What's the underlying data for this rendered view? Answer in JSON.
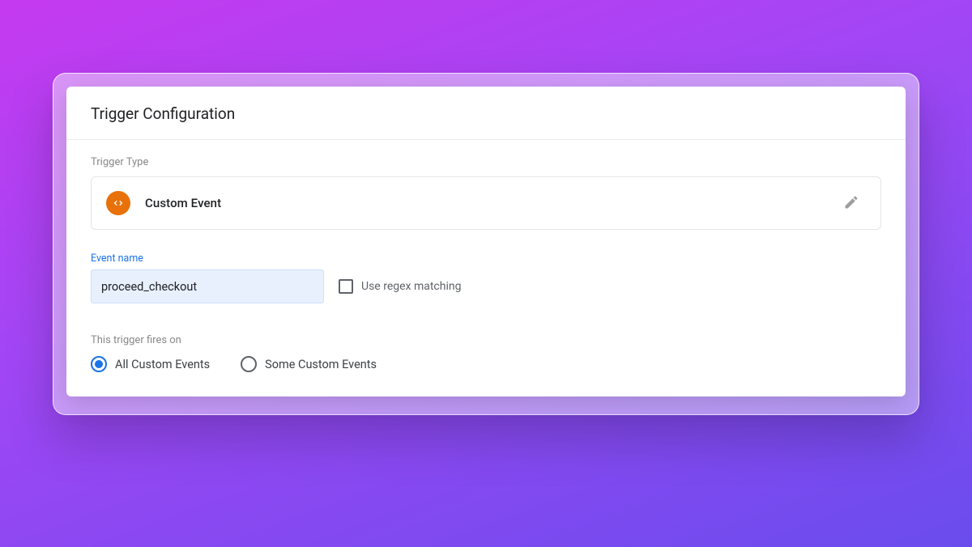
{
  "header": {
    "title": "Trigger Configuration"
  },
  "trigger_type": {
    "label": "Trigger Type",
    "name": "Custom Event"
  },
  "event": {
    "label": "Event name",
    "value": "proceed_checkout",
    "regex_label": "Use regex matching",
    "regex_checked": false
  },
  "fires": {
    "label": "This trigger fires on",
    "options": [
      {
        "label": "All Custom Events",
        "selected": true
      },
      {
        "label": "Some Custom Events",
        "selected": false
      }
    ]
  }
}
